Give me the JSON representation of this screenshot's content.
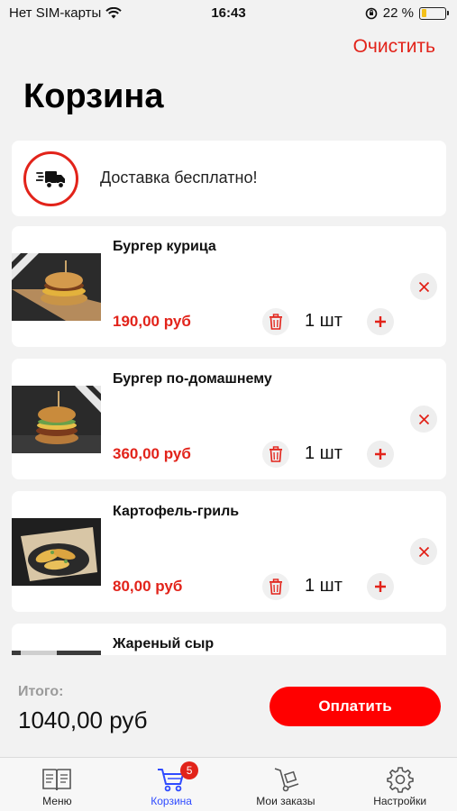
{
  "status_bar": {
    "carrier": "Нет SIM-карты",
    "time": "16:43",
    "battery": "22 %",
    "battery_level": 0.22
  },
  "header": {
    "clear_label": "Очистить",
    "title": "Корзина"
  },
  "delivery": {
    "text": "Доставка бесплатно!",
    "icon": "delivery-truck-icon"
  },
  "items": [
    {
      "name": "Бургер курица",
      "price": "190,00 руб",
      "qty": "1 шт"
    },
    {
      "name": "Бургер по-домашнему",
      "price": "360,00 руб",
      "qty": "1 шт"
    },
    {
      "name": "Картофель-гриль",
      "price": "80,00 руб",
      "qty": "1 шт"
    },
    {
      "name": "Жареный сыр",
      "price": "",
      "qty": ""
    }
  ],
  "footer": {
    "total_label": "Итого:",
    "total_value": "1040,00 руб",
    "pay_label": "Оплатить"
  },
  "tabs": [
    {
      "label": "Меню",
      "icon": "menu-book-icon"
    },
    {
      "label": "Корзина",
      "icon": "cart-icon",
      "badge": "5",
      "active": true
    },
    {
      "label": "Мои заказы",
      "icon": "hand-truck-icon"
    },
    {
      "label": "Настройки",
      "icon": "gear-icon"
    }
  ],
  "colors": {
    "accent": "#e2231a",
    "pay_button": "#ff0000",
    "active_tab": "#2f4bff",
    "background": "#f2f2f2"
  }
}
